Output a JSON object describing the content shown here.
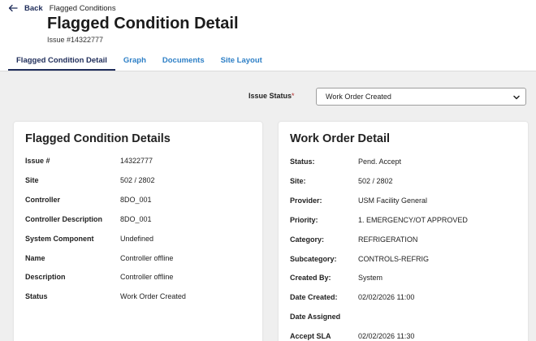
{
  "nav": {
    "back_label": "Back",
    "breadcrumb": "Flagged Conditions"
  },
  "page": {
    "title": "Flagged Condition Detail",
    "issue_subtitle": "Issue #14322777"
  },
  "tabs": [
    {
      "label": "Flagged Condition Detail",
      "active": true
    },
    {
      "label": "Graph",
      "active": false
    },
    {
      "label": "Documents",
      "active": false
    },
    {
      "label": "Site Layout",
      "active": false
    }
  ],
  "issue_status": {
    "label": "Issue Status",
    "required_mark": "*",
    "selected": "Work Order Created"
  },
  "flagged_details": {
    "title": "Flagged Condition Details",
    "rows": [
      {
        "key": "Issue #",
        "value": "14322777"
      },
      {
        "key": "Site",
        "value": "502 / 2802"
      },
      {
        "key": "Controller",
        "value": "8DO_001"
      },
      {
        "key": "Controller Description",
        "value": "8DO_001"
      },
      {
        "key": "System Component",
        "value": "Undefined"
      },
      {
        "key": "Name",
        "value": "Controller offline"
      },
      {
        "key": "Description",
        "value": "Controller offline"
      },
      {
        "key": "Status",
        "value": "Work Order Created"
      }
    ]
  },
  "work_order": {
    "title": "Work Order Detail",
    "rows": [
      {
        "key": "Status:",
        "value": "Pend. Accept"
      },
      {
        "key": "Site:",
        "value": "502 / 2802"
      },
      {
        "key": "Provider:",
        "value": "USM Facility General"
      },
      {
        "key": "Priority:",
        "value": "1. EMERGENCY/OT APPROVED"
      },
      {
        "key": "Category:",
        "value": "REFRIGERATION"
      },
      {
        "key": "Subcategory:",
        "value": "CONTROLS-REFRIG"
      },
      {
        "key": "Created By:",
        "value": "System"
      },
      {
        "key": "Date Created:",
        "value": "02/02/2026 11:00"
      },
      {
        "key": "Date Assigned",
        "value": ""
      },
      {
        "key": "Accept SLA",
        "value": "02/02/2026 11:30"
      }
    ]
  },
  "colors": {
    "nav_dark": "#1f2d5a",
    "tab_link": "#2d7fc6",
    "background": "#efefef",
    "card": "#ffffff"
  }
}
